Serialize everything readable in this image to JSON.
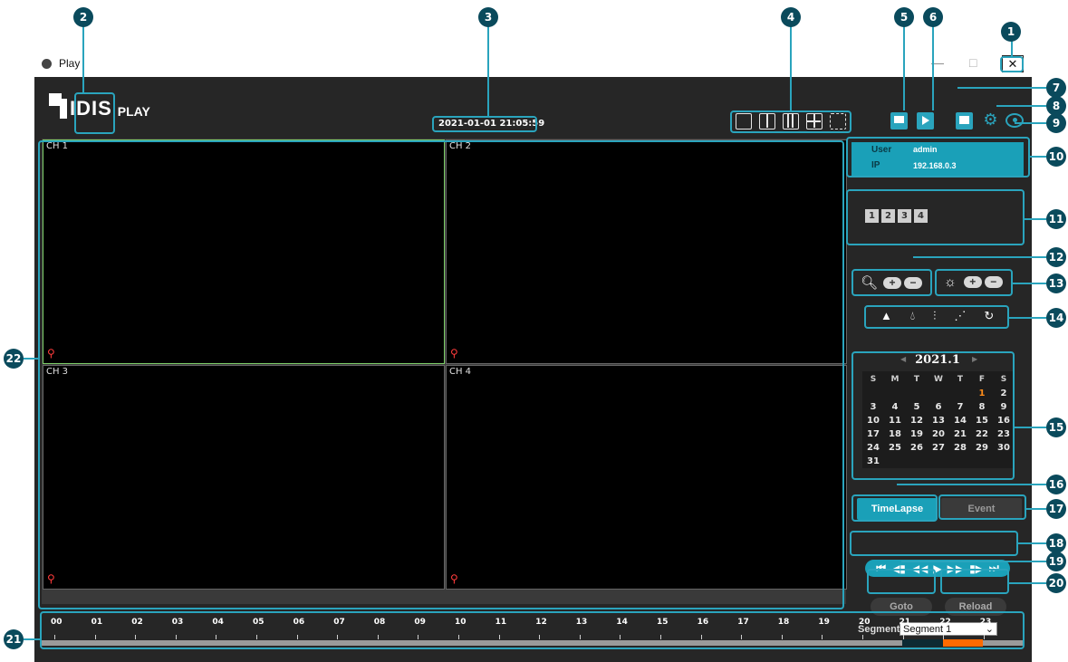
{
  "window": {
    "title": "Play",
    "close_glyph": "✕",
    "minimize_glyph": "—",
    "maximize_glyph": "□"
  },
  "header": {
    "logo_text": "IDIS",
    "logo_sub": "PLAY",
    "datetime": "2021-01-01 21:05:59"
  },
  "layout_icons": [
    "single-view-icon",
    "split-2-icon",
    "split-3-icon",
    "split-4-icon",
    "fullscreen-icon"
  ],
  "toolbar_icons": [
    "print-icon",
    "export-video-icon",
    "export-image-icon",
    "settings-gear-icon",
    "view-eye-icon"
  ],
  "channels": [
    {
      "label": "CH 1"
    },
    {
      "label": "CH 2"
    },
    {
      "label": "CH 3"
    },
    {
      "label": "CH 4"
    }
  ],
  "info": {
    "user_label": "User",
    "user_value": "admin",
    "ip_label": "IP",
    "ip_value": "192.168.0.3"
  },
  "channel_buttons": [
    "1",
    "2",
    "3",
    "4"
  ],
  "zoom": {
    "plus": "+",
    "minus": "−"
  },
  "brightness": {
    "plus": "+",
    "minus": "−"
  },
  "calendar": {
    "title": "2021.1",
    "prev": "◀",
    "next": "▶",
    "weekdays": [
      "S",
      "M",
      "T",
      "W",
      "T",
      "F",
      "S"
    ],
    "rows": [
      [
        "",
        "",
        "",
        "",
        "",
        "1",
        "2"
      ],
      [
        "3",
        "4",
        "5",
        "6",
        "7",
        "8",
        "9"
      ],
      [
        "10",
        "11",
        "12",
        "13",
        "14",
        "15",
        "16"
      ],
      [
        "17",
        "18",
        "19",
        "20",
        "21",
        "22",
        "23"
      ],
      [
        "24",
        "25",
        "26",
        "27",
        "28",
        "29",
        "30"
      ],
      [
        "31",
        "",
        "",
        "",
        "",
        "",
        ""
      ]
    ],
    "highlight_day": "1",
    "highlight_color": "#ff8c1a"
  },
  "modes": {
    "timelapse": "TimeLapse",
    "event": "Event"
  },
  "playback": [
    "⏮",
    "◀▮",
    "◀◀",
    "▶",
    "▶▶",
    "▮▶",
    "⏭"
  ],
  "actions": {
    "goto": "Goto",
    "reload": "Reload"
  },
  "segment": {
    "label": "Segment",
    "selected": "Segment 1"
  },
  "timeline": {
    "hours": [
      "00",
      "01",
      "02",
      "03",
      "04",
      "05",
      "06",
      "07",
      "08",
      "09",
      "10",
      "11",
      "12",
      "13",
      "14",
      "15",
      "16",
      "17",
      "18",
      "19",
      "20",
      "21",
      "22",
      "23"
    ],
    "recorded_color": "#ff6a00",
    "bar_color": "#9a9a9a"
  },
  "callouts": [
    "1",
    "2",
    "3",
    "4",
    "5",
    "6",
    "7",
    "8",
    "9",
    "10",
    "11",
    "12",
    "13",
    "14",
    "15",
    "16",
    "17",
    "18",
    "19",
    "20",
    "21",
    "22"
  ],
  "colors": {
    "accent": "#2aa4bd",
    "badge": "#0a4a5c",
    "active_button": "#1aa0b8"
  }
}
